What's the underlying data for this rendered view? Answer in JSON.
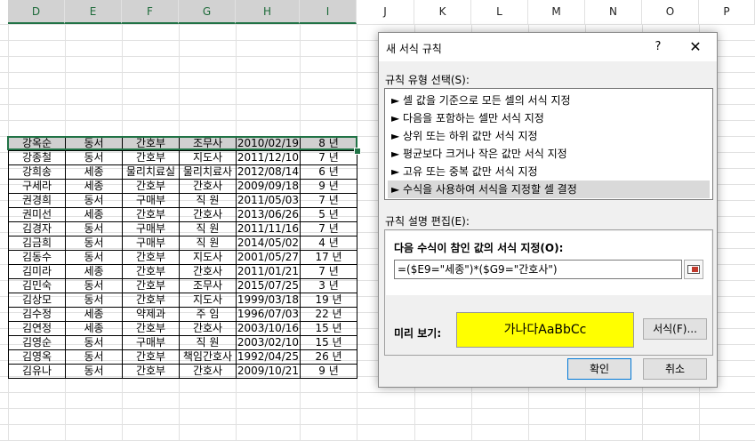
{
  "columns": [
    "D",
    "E",
    "F",
    "G",
    "H",
    "I",
    "J",
    "K",
    "L",
    "M",
    "N",
    "O",
    "P"
  ],
  "selected_columns": [
    "D",
    "E",
    "F",
    "G",
    "H",
    "I"
  ],
  "rows": [
    [
      "강옥순",
      "동서",
      "간호부",
      "조무사",
      "2010/02/19",
      "8 년"
    ],
    [
      "강종철",
      "동서",
      "간호부",
      "지도사",
      "2011/12/10",
      "7 년"
    ],
    [
      "강희송",
      "세종",
      "물리치료실",
      "물리치료사",
      "2012/08/14",
      "6 년"
    ],
    [
      "구세라",
      "세종",
      "간호부",
      "간호사",
      "2009/09/18",
      "9 년"
    ],
    [
      "권경희",
      "동서",
      "구매부",
      "직  원",
      "2011/05/03",
      "7 년"
    ],
    [
      "권미선",
      "세종",
      "간호부",
      "간호사",
      "2013/06/26",
      "5 년"
    ],
    [
      "김경자",
      "동서",
      "구매부",
      "직  원",
      "2011/11/16",
      "7 년"
    ],
    [
      "김금희",
      "동서",
      "구매부",
      "직  원",
      "2014/05/02",
      "4 년"
    ],
    [
      "김동수",
      "동서",
      "간호부",
      "지도사",
      "2001/05/27",
      "17 년"
    ],
    [
      "김미라",
      "세종",
      "간호부",
      "간호사",
      "2011/01/21",
      "7 년"
    ],
    [
      "김민숙",
      "동서",
      "간호부",
      "조무사",
      "2015/07/25",
      "3 년"
    ],
    [
      "김상모",
      "동서",
      "간호부",
      "지도사",
      "1999/03/18",
      "19 년"
    ],
    [
      "김수정",
      "세종",
      "약제과",
      "주  임",
      "1996/07/03",
      "22 년"
    ],
    [
      "김연정",
      "세종",
      "간호부",
      "간호사",
      "2003/10/16",
      "15 년"
    ],
    [
      "김영순",
      "동서",
      "구매부",
      "직  원",
      "2003/02/10",
      "15 년"
    ],
    [
      "김영옥",
      "동서",
      "간호부",
      "책임간호사",
      "1992/04/25",
      "26 년"
    ],
    [
      "김유나",
      "동서",
      "간호부",
      "간호사",
      "2009/10/21",
      "9 년"
    ]
  ],
  "dialog": {
    "title": "새 서식 규칙",
    "help": "?",
    "close": "✕",
    "rule_type_label": "규칙 유형 선택(S):",
    "rules": [
      "► 셀 값을 기준으로 모든 셀의 서식 지정",
      "► 다음을 포함하는 셀만 서식 지정",
      "► 상위 또는 하위 값만 서식 지정",
      "► 평균보다 크거나 작은 값만 서식 지정",
      "► 고유 또는 중복 값만 서식 지정",
      "► 수식을 사용하여 서식을 지정할 셀 결정"
    ],
    "selected_rule_index": 5,
    "edit_label": "규칙 설명 편집(E):",
    "formula_label": "다음 수식이 참인 값의 서식 지정(O):",
    "formula_value": "=($E9=\"세종\")*($G9=\"간호사\")",
    "preview_label": "미리 보기:",
    "preview_text": "가나다AaBbCc",
    "preview_color": "#ffff00",
    "format_button": "서식(F)...",
    "ok_button": "확인",
    "cancel_button": "취소"
  }
}
